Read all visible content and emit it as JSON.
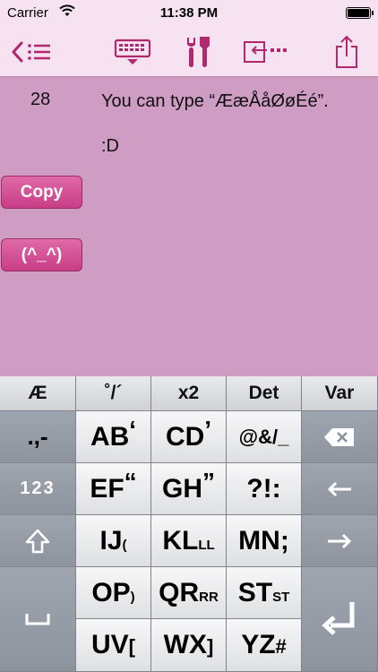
{
  "status_bar": {
    "carrier": "Carrier",
    "time": "11:38 PM",
    "icons": [
      "wifi-icon",
      "battery-icon"
    ]
  },
  "toolbar": {
    "items": [
      "back-list-icon",
      "keyboard-hide-icon",
      "tools-icon",
      "insert-icon",
      "share-icon"
    ]
  },
  "content": {
    "line_number": "28",
    "message": "You can type “ÆæÅåØøÉé”.",
    "emote": ":D",
    "copy_button": "Copy",
    "kaomoji_button": "(^_^)"
  },
  "keyboard": {
    "top_row": {
      "ae": "Æ",
      "accents": "˚/´",
      "x2": "x2",
      "det": "Det",
      "var": "Var"
    },
    "rows": [
      {
        "left": ".,-",
        "keys": [
          [
            "AB",
            "‘"
          ],
          [
            "CD",
            "’"
          ],
          [
            "@&/_",
            ""
          ]
        ],
        "right": "backspace-icon"
      },
      {
        "left": "123",
        "keys": [
          [
            "EF",
            "“"
          ],
          [
            "GH",
            "”"
          ],
          [
            "?!:",
            ""
          ]
        ],
        "right": "left-arrow-icon"
      },
      {
        "left": "shift-icon",
        "keys": [
          [
            "IJ",
            "("
          ],
          [
            "KL",
            "LL"
          ],
          [
            "MN;",
            ""
          ]
        ],
        "right": "right-arrow-icon"
      },
      {
        "left": "space-icon",
        "keys": [
          [
            "OP",
            ")"
          ],
          [
            "QR",
            "RR"
          ],
          [
            "ST",
            "ST"
          ]
        ],
        "right": "return-icon"
      },
      {
        "keys": [
          [
            "UV",
            "["
          ],
          [
            "WX",
            "]"
          ],
          [
            "YZ",
            "#"
          ]
        ]
      }
    ],
    "labels": {
      "r1_left": ".,-",
      "r1_k1": "AB",
      "r1_k1s": "‘",
      "r1_k2": "CD",
      "r1_k2s": "’",
      "r1_k3": "@&/_",
      "r2_left": "123",
      "r2_k1": "EF",
      "r2_k1s": "“",
      "r2_k2": "GH",
      "r2_k2s": "”",
      "r2_k3": "?!:",
      "r3_k1": "IJ",
      "r3_k1s": "(",
      "r3_k2": "KL",
      "r3_k2s": "LL",
      "r3_k3": "MN;",
      "r4_k1": "OP",
      "r4_k1s": ")",
      "r4_k2": "QR",
      "r4_k2s": "RR",
      "r4_k3": "ST",
      "r4_k3s": "ST",
      "r5_k1": "UV",
      "r5_k1s": "[",
      "r5_k2": "WX",
      "r5_k2s": "]",
      "r5_k3": "YZ",
      "r5_k3s": "#"
    }
  },
  "colors": {
    "background": "#cf9cc4",
    "toolbar": "#f6e2f0",
    "accent": "#b0286e",
    "button": "#d54f96"
  }
}
